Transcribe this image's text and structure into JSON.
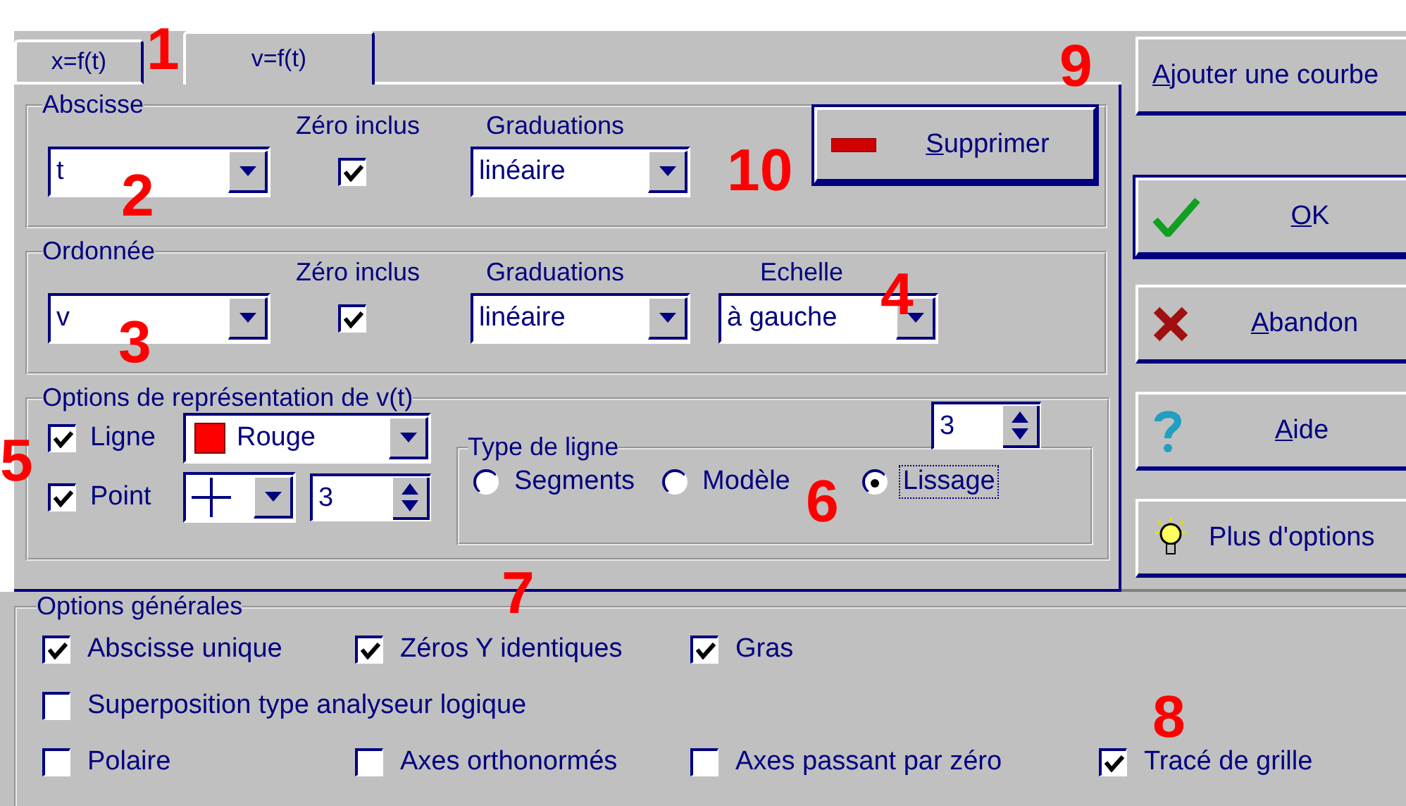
{
  "tabs": [
    {
      "label": "x=f(t)",
      "selected": false
    },
    {
      "label": "v=f(t)",
      "selected": true
    }
  ],
  "abscisse": {
    "legend": "Abscisse",
    "zero_label": "Zéro inclus",
    "grad_label": "Graduations",
    "variable": "t",
    "zero_included": true,
    "graduations": "linéaire"
  },
  "delete_button": {
    "label": "Supprimer",
    "mnemonic": true
  },
  "ordonnee": {
    "legend": "Ordonnée",
    "zero_label": "Zéro inclus",
    "grad_label": "Graduations",
    "scale_label": "Echelle",
    "variable": "v",
    "zero_included": true,
    "graduations": "linéaire",
    "scale": "à gauche"
  },
  "representation": {
    "legend": "Options de représentation de v(t)",
    "line": {
      "label": "Ligne",
      "checked": true,
      "color_name": "Rouge",
      "color": "#ff0000"
    },
    "point": {
      "label": "Point",
      "checked": true,
      "size": "3"
    },
    "line_type": {
      "legend": "Type de ligne",
      "smoothing": "3",
      "options": [
        {
          "label": "Segments",
          "selected": false
        },
        {
          "label": "Modèle",
          "selected": false
        },
        {
          "label": "Lissage",
          "selected": true
        }
      ]
    }
  },
  "actions": [
    {
      "label": "Ajouter une courbe",
      "kind": "plain",
      "mnemonic": true
    },
    {
      "label": "OK",
      "kind": "check",
      "mnemonic": true
    },
    {
      "label": "Abandon",
      "kind": "cross",
      "mnemonic": true
    },
    {
      "label": "Aide",
      "kind": "help",
      "mnemonic": true
    },
    {
      "label": "Plus d'options",
      "kind": "bulb",
      "mnemonic": false
    }
  ],
  "general_options": {
    "legend": "Options générales",
    "rows": [
      [
        {
          "label": "Abscisse unique",
          "checked": true
        },
        {
          "label": "Zéros Y identiques",
          "checked": true
        },
        {
          "label": "Gras",
          "checked": true
        }
      ],
      [
        {
          "label": "Superposition type analyseur logique",
          "checked": false
        }
      ],
      [
        {
          "label": "Polaire",
          "checked": false
        },
        {
          "label": "Axes orthonormés",
          "checked": false
        },
        {
          "label": "Axes passant par zéro",
          "checked": false
        },
        {
          "label": "Tracé de grille",
          "checked": true
        }
      ]
    ]
  },
  "annotations": [
    "1",
    "2",
    "3",
    "4",
    "5",
    "6",
    "7",
    "8",
    "9",
    "10"
  ]
}
